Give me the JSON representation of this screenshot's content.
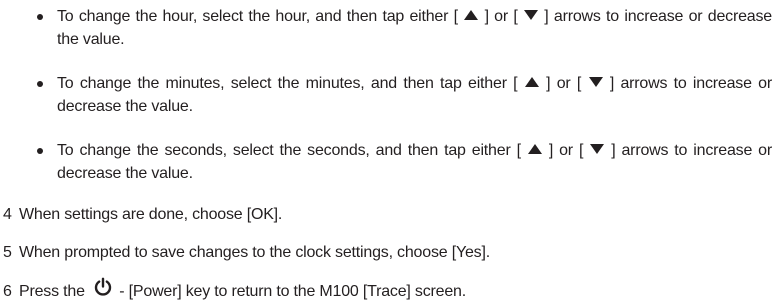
{
  "bullets": [
    {
      "part1": "To change the hour, select the hour, and then tap either [ ",
      "part2": " ] or [ ",
      "part3": " ] arrows to increase or decrease the value."
    },
    {
      "part1": "To change the minutes, select the minutes, and then tap either [ ",
      "part2": " ] or [ ",
      "part3": " ] arrows to increase or decrease the value."
    },
    {
      "part1": "To change the seconds, select the seconds, and then tap either [ ",
      "part2": " ] or [ ",
      "part3": " ] arrows to increase or decrease the value."
    }
  ],
  "steps": [
    {
      "number": "4",
      "text": "When settings are done, choose [OK]."
    },
    {
      "number": "5",
      "text": "When prompted to save changes to the clock settings, choose [Yes]."
    },
    {
      "number": "6",
      "pre": "Press the ",
      "post": " - [Power] key to return to the M100 [Trace] screen."
    }
  ],
  "icons": {
    "up_arrow": "triangle-up-icon",
    "down_arrow": "triangle-down-icon",
    "power": "power-icon"
  }
}
